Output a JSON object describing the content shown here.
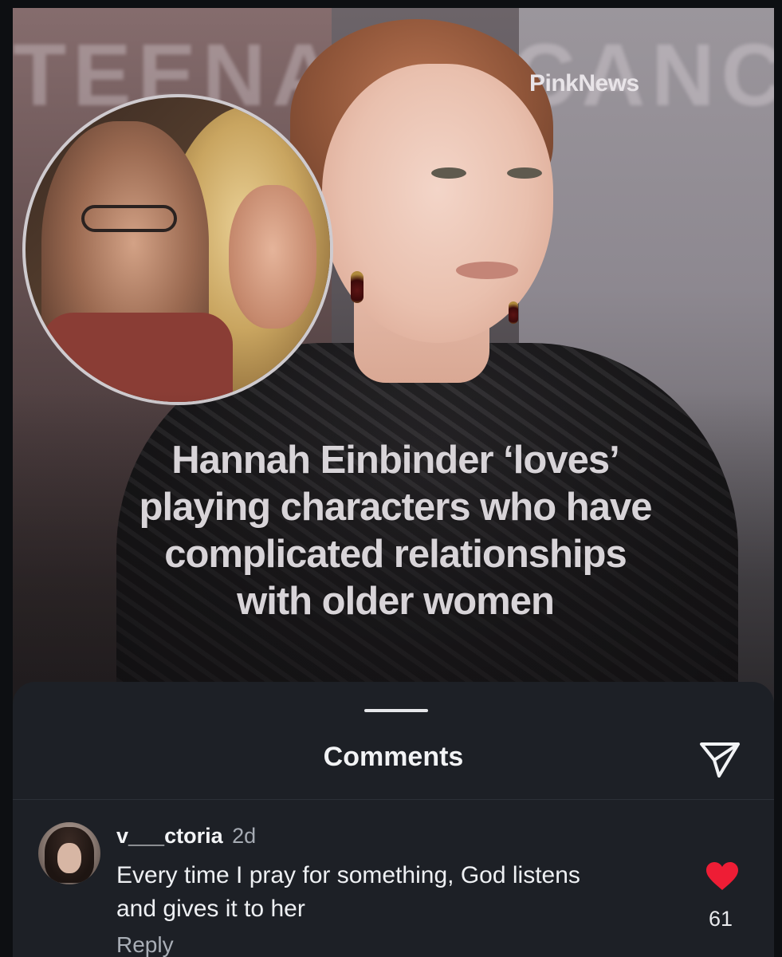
{
  "post": {
    "brand": "PinkNews",
    "background_text": "TEENAGE CANCER",
    "headline_lines": [
      "Hannah Einbinder ‘loves’",
      "playing characters who have",
      "complicated relationships",
      "with older women"
    ]
  },
  "comments_sheet": {
    "title": "Comments",
    "share_icon": "paper-plane-icon",
    "items": [
      {
        "username": "v___ctoria",
        "time": "2d",
        "lines": [
          "Every time I pray for something, God listens",
          "and gives it to her"
        ],
        "reply_label": "Reply",
        "like_icon": "heart-icon",
        "liked": true,
        "like_count": "61"
      }
    ]
  },
  "colors": {
    "sheet_background": "#1d2026",
    "heart": "#ee1d35",
    "accent_pink": "#d24aa0",
    "accent_teal": "#39b7b3"
  }
}
